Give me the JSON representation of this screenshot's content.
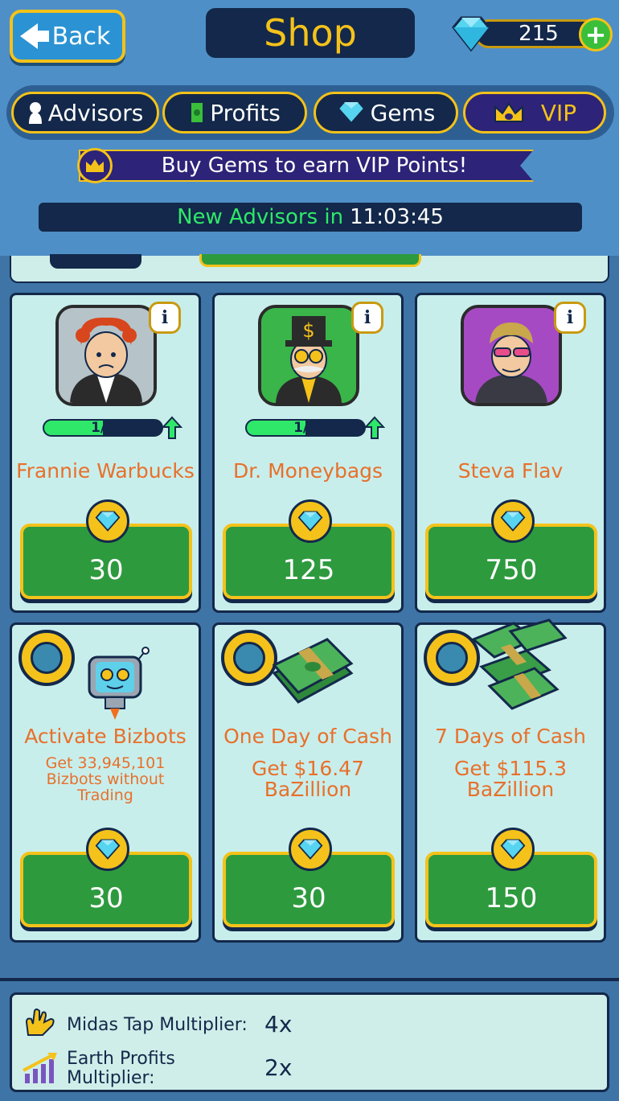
{
  "header": {
    "back_label": "Back",
    "title": "Shop",
    "gem_count": "215",
    "plus": "+"
  },
  "tabs": [
    {
      "label": "Advisors"
    },
    {
      "label": "Profits"
    },
    {
      "label": "Gems"
    },
    {
      "label": "VIP"
    }
  ],
  "vip_banner": "Buy Gems to earn VIP Points!",
  "timer": {
    "label": "New Advisors in",
    "value": "11:03:45"
  },
  "advisors": [
    {
      "name": "Frannie Warbucks",
      "progress_text": "1/2",
      "progress": 0.5,
      "price": "30"
    },
    {
      "name": "Dr. Moneybags",
      "progress_text": "1/2",
      "progress": 0.5,
      "price": "125"
    },
    {
      "name": "Steva Flav",
      "price": "750"
    }
  ],
  "boosts": [
    {
      "name": "Activate Bizbots",
      "desc": [
        "Get 33,945,101",
        "Bizbots without",
        "Trading"
      ],
      "price": "30"
    },
    {
      "name": "One Day of Cash",
      "desc": [
        "Get $16.47",
        "BaZillion"
      ],
      "price": "30"
    },
    {
      "name": "7 Days of Cash",
      "desc": [
        "Get $115.3",
        "BaZillion"
      ],
      "price": "150"
    }
  ],
  "stats": [
    {
      "label": "Midas Tap Multiplier:",
      "value": "4x"
    },
    {
      "label_line1": "Earth Profits",
      "label_line2": "Multiplier:",
      "value": "2x"
    }
  ],
  "colors": {
    "accent_gold": "#f4c21a",
    "navy": "#13284a",
    "button_green": "#2e9a3e",
    "name_orange": "#e8702a",
    "timer_green": "#2fe86a"
  }
}
